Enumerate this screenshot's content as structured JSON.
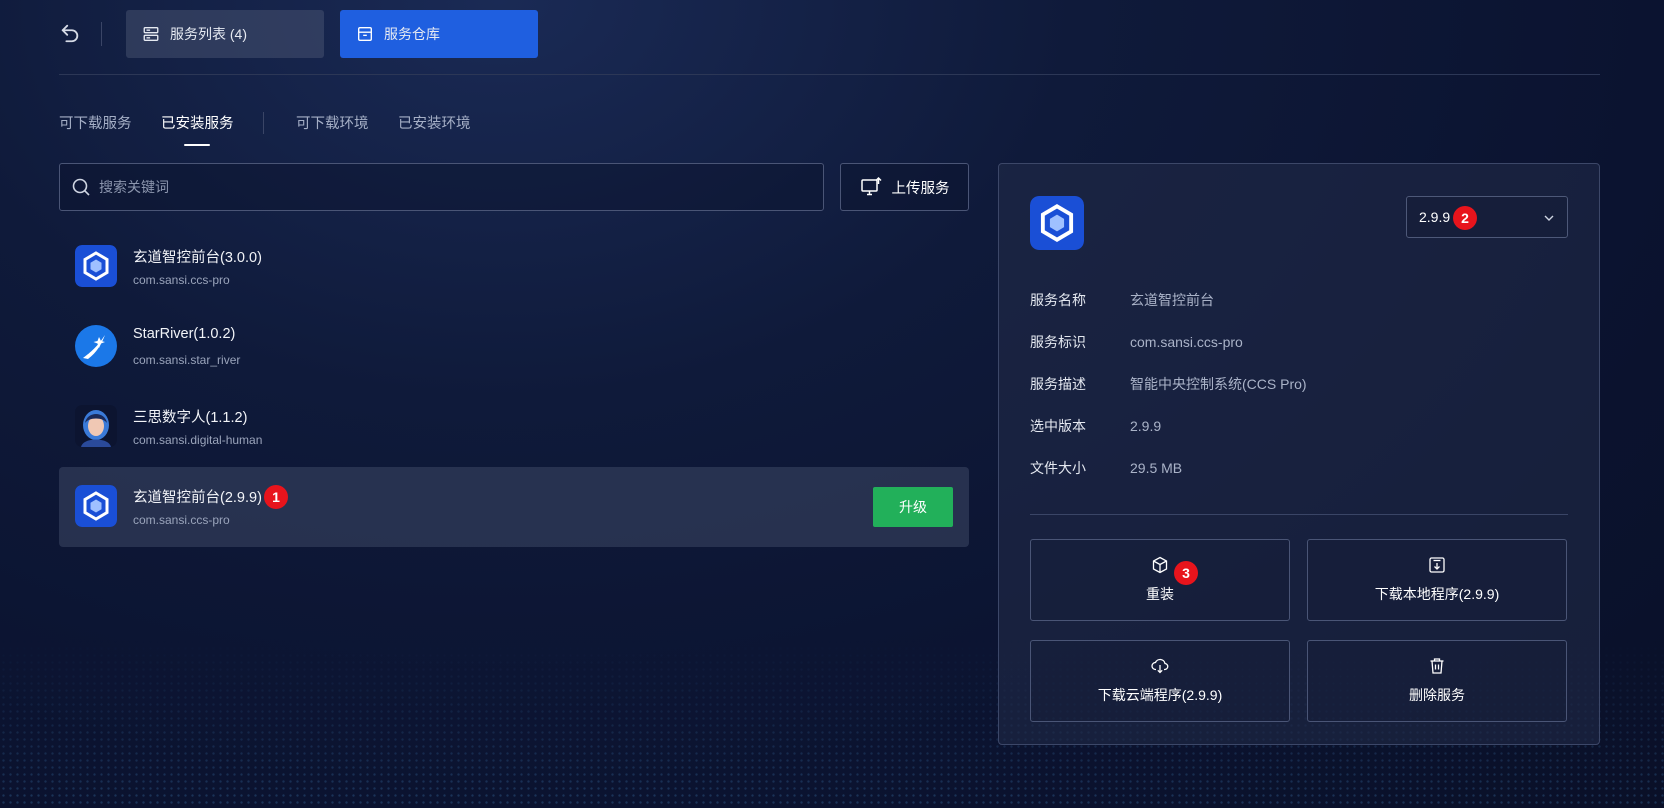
{
  "topbar": {
    "back_icon": "undo-icon",
    "service_list_label": "服务列表 (4)",
    "warehouse_label": "服务仓库"
  },
  "tabs": [
    {
      "label": "可下载服务",
      "active": false
    },
    {
      "label": "已安装服务",
      "active": true
    },
    {
      "label": "可下载环境",
      "active": false
    },
    {
      "label": "已安装环境",
      "active": false
    }
  ],
  "search": {
    "placeholder": "搜索关键词",
    "value": ""
  },
  "upload_label": "上传服务",
  "services": [
    {
      "name": "玄道智控前台(3.0.0)",
      "id": "com.sansi.ccs-pro",
      "icon": "hexagon-logo-icon"
    },
    {
      "name": "StarRiver(1.0.2)",
      "id": "com.sansi.star_river",
      "icon": "star-river-logo-icon"
    },
    {
      "name": "三思数字人(1.1.2)",
      "id": "com.sansi.digital-human",
      "icon": "digital-human-avatar"
    },
    {
      "name": "玄道智控前台(2.9.9)",
      "id": "com.sansi.ccs-pro",
      "icon": "hexagon-logo-icon",
      "selected": true,
      "badge": "1",
      "action_label": "升级"
    }
  ],
  "detail": {
    "version": "2.9.9",
    "version_badge": "2",
    "fields": [
      {
        "label": "服务名称",
        "value": "玄道智控前台"
      },
      {
        "label": "服务标识",
        "value": "com.sansi.ccs-pro"
      },
      {
        "label": "服务描述",
        "value": "智能中央控制系统(CCS Pro)"
      },
      {
        "label": "选中版本",
        "value": "2.9.9"
      },
      {
        "label": "文件大小",
        "value": "29.5 MB"
      }
    ],
    "actions": {
      "reinstall": "重装",
      "reinstall_badge": "3",
      "download_local": "下载本地程序(2.9.9)",
      "download_cloud": "下载云端程序(2.9.9)",
      "delete": "删除服务"
    }
  },
  "colors": {
    "accent": "#1f5fe0",
    "upgrade": "#22b05a",
    "badge": "#e8141c",
    "background": "#0f1a3a"
  }
}
